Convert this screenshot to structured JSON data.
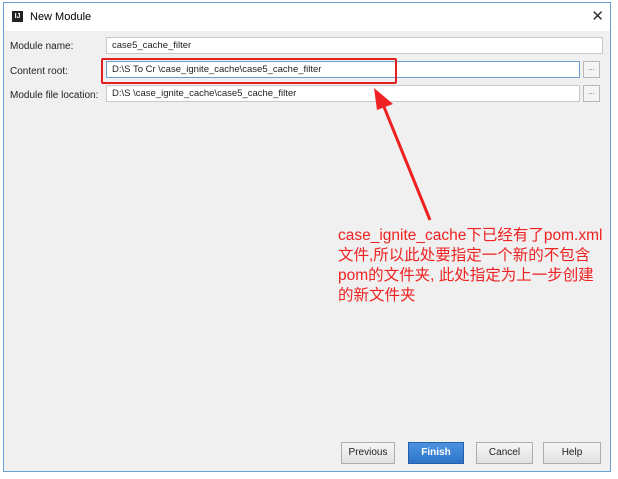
{
  "window": {
    "title": "New Module",
    "close_label": "✕"
  },
  "form": {
    "module_name": {
      "label": "Module name:",
      "value": "case5_cache_filter"
    },
    "content_root": {
      "label": "Content root:",
      "value": "D:\\S         To Cr    \\case_ignite_cache\\case5_cache_filter"
    },
    "module_file_location": {
      "label": "Module file location:",
      "value": "D:\\S             \\case_ignite_cache\\case5_cache_filter"
    },
    "browse_label": "..."
  },
  "buttons": {
    "previous": "Previous",
    "finish": "Finish",
    "cancel": "Cancel",
    "help": "Help"
  },
  "annotation": {
    "text": "case_ignite_cache下已经有了pom.xml文件,所以此处要指定一个新的不包含pom的文件夹, 此处指定为上一步创建的新文件夹",
    "color": "#e22222"
  }
}
